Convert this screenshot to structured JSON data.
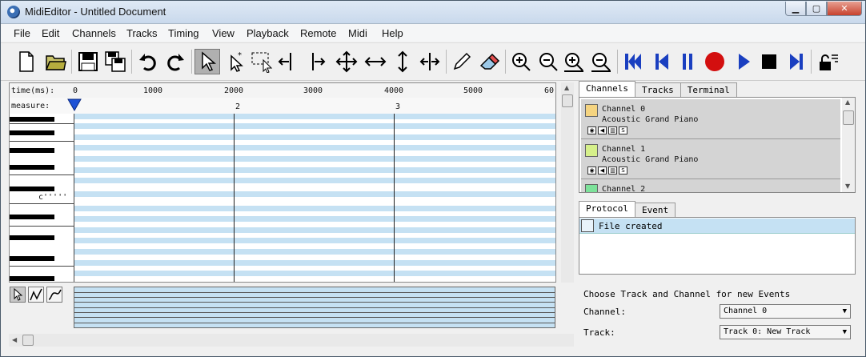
{
  "window": {
    "title": "MidiEditor - Untitled Document"
  },
  "menu": [
    "File",
    "Edit",
    "Channels",
    "Tracks",
    "Timing",
    "View",
    "Playback",
    "Remote",
    "Midi",
    "Help"
  ],
  "toolbar_icons": [
    "new-document-icon",
    "open-folder-icon",
    "save-icon",
    "save-as-icon",
    "undo-icon",
    "redo-icon",
    "select-single-icon",
    "select-new-icon",
    "select-box-icon",
    "select-left-icon",
    "select-right-icon",
    "move-all-icon",
    "move-horizontal-icon",
    "move-vertical-icon",
    "resize-icon",
    "pencil-icon",
    "eraser-icon",
    "zoom-in-horizontal-icon",
    "zoom-out-horizontal-icon",
    "zoom-in-vertical-icon",
    "zoom-out-vertical-icon",
    "back-to-begin-icon",
    "back-icon",
    "pause-icon",
    "record-icon",
    "play-icon",
    "stop-icon",
    "forward-icon",
    "lock-icon"
  ],
  "ruler": {
    "label": "time(ms):",
    "ticks": [
      "0",
      "1000",
      "2000",
      "3000",
      "4000",
      "5000",
      "60"
    ]
  },
  "measure": {
    "label": "measure:",
    "numbers": [
      "2",
      "3"
    ]
  },
  "piano": {
    "note_label": "c'''''"
  },
  "right_tabs": [
    "Channels",
    "Tracks",
    "Terminal"
  ],
  "channels": [
    {
      "name": "Channel 0",
      "instrument": "Acoustic Grand Piano",
      "color": "#f5d480"
    },
    {
      "name": "Channel 1",
      "instrument": "Acoustic Grand Piano",
      "color": "#d6f08a"
    },
    {
      "name": "Channel 2",
      "instrument": "",
      "color": "#7de29a"
    }
  ],
  "channel_icon_labels": [
    "S"
  ],
  "bottom_tabs": [
    "Protocol",
    "Event"
  ],
  "protocol": [
    {
      "text": "File created"
    }
  ],
  "new_events": {
    "heading": "Choose Track and Channel for new Events",
    "channel_label": "Channel:",
    "channel_value": "Channel 0",
    "track_label": "Track:",
    "track_value": "Track 0: New Track"
  }
}
